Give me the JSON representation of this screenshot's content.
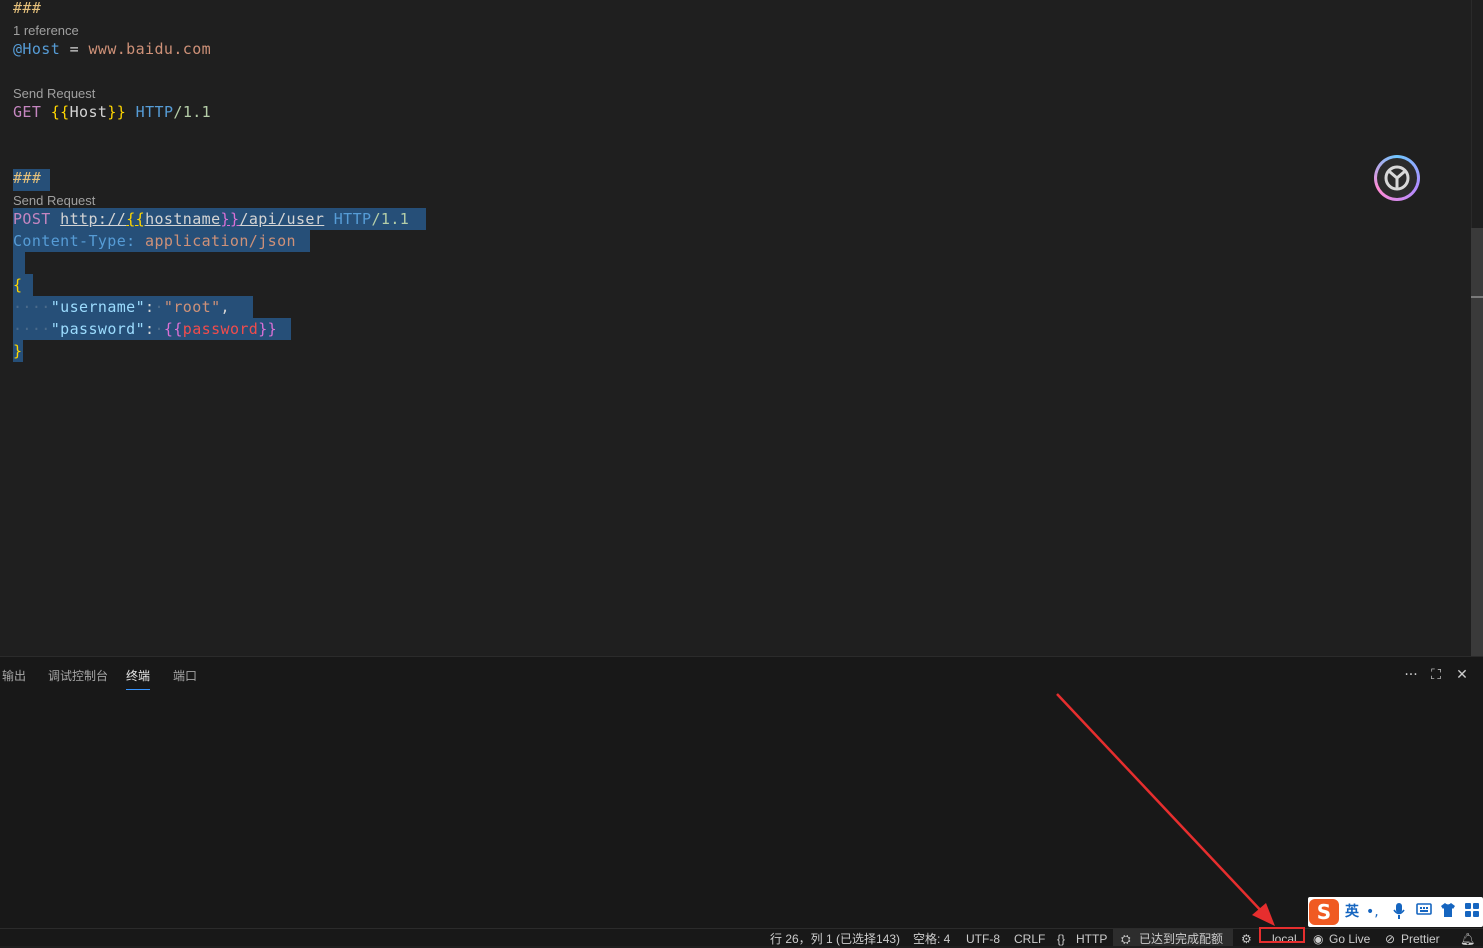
{
  "editor": {
    "lines": {
      "l1": "###",
      "lens1": "1 reference",
      "host_var": "@Host",
      "host_eq": " = ",
      "host_val": "www.baidu.com",
      "lens2": "Send Request",
      "get_method": "GET",
      "get_open": "{{",
      "get_var": "Host",
      "get_close": "}}",
      "get_proto": "HTTP",
      "get_ver": "/1.1",
      "l_sep": "###",
      "lens3": "Send Request",
      "post_method": "POST",
      "post_url1": "http://",
      "post_open": "{{",
      "post_var": "hostname",
      "post_close": "}}",
      "post_url2": "/api/user",
      "post_proto": "HTTP",
      "post_ver": "/1.1",
      "ct_name": "Content-Type:",
      "ct_val": "application/json",
      "brace_open": "{",
      "json_user_key": "\"username\"",
      "json_user_val": "\"root\"",
      "json_pass_key": "\"password\"",
      "json_pass_open": "{{",
      "json_pass_var": "password",
      "json_pass_close": "}}",
      "brace_close": "}"
    }
  },
  "panel": {
    "tabs": [
      "输出",
      "调试控制台",
      "终端",
      "端口"
    ],
    "active_tab": "终端",
    "actions": {
      "more": "···",
      "maximize": "⛶",
      "close": "✕"
    }
  },
  "statusbar": {
    "position": "行 26，列 1 (已选择143)",
    "indent": "空格: 4",
    "encoding": "UTF-8",
    "eol": "CRLF",
    "language": "HTTP",
    "copilot_status": "已达到完成配额",
    "environment": "local",
    "golive": "Go Live",
    "prettier": "Prettier"
  },
  "ime": {
    "logo": "S",
    "mode": "英"
  },
  "colors": {
    "selection": "#264f78",
    "annotation_red": "#e62e2e",
    "accent_blue": "#3794ff"
  }
}
